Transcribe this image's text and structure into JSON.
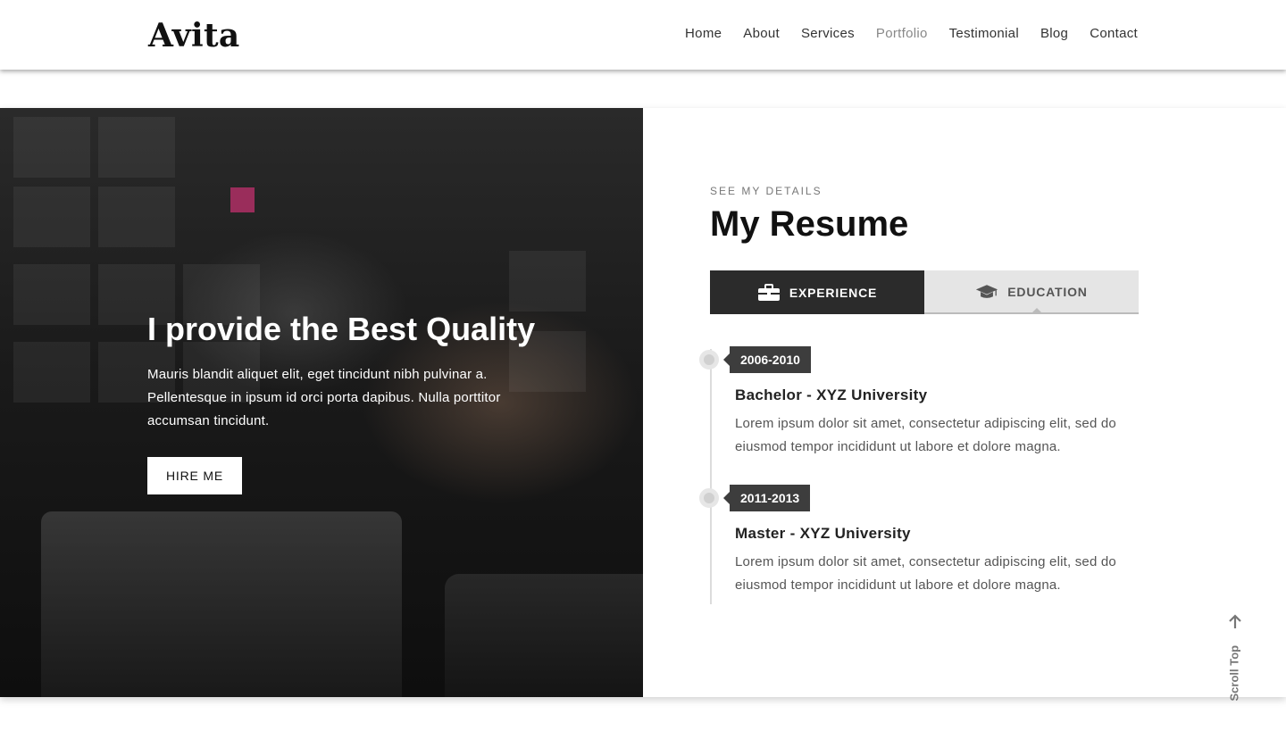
{
  "header": {
    "brand": "Avita",
    "nav": [
      {
        "label": "Home",
        "active": false
      },
      {
        "label": "About",
        "active": false
      },
      {
        "label": "Services",
        "active": false
      },
      {
        "label": "Portfolio",
        "active": true
      },
      {
        "label": "Testimonial",
        "active": false
      },
      {
        "label": "Blog",
        "active": false
      },
      {
        "label": "Contact",
        "active": false
      }
    ]
  },
  "hero": {
    "title": "I provide the Best Quality",
    "text": "Mauris blandit aliquet elit, eget tincidunt nibh pulvinar a. Pellentesque in ipsum id orci porta dapibus. Nulla porttitor accumsan tincidunt.",
    "button": "HIRE ME"
  },
  "resume": {
    "eyebrow": "SEE MY DETAILS",
    "title": "My Resume",
    "tabs": [
      {
        "label": "EXPERIENCE",
        "icon": "briefcase-icon",
        "active": true
      },
      {
        "label": "EDUCATION",
        "icon": "graduation-cap-icon",
        "active": false
      }
    ],
    "timeline": [
      {
        "date": "2006-2010",
        "title": "Bachelor - XYZ University",
        "desc": "Lorem ipsum dolor sit amet, consectetur adipiscing elit, sed do eiusmod tempor incididunt ut labore et dolore magna."
      },
      {
        "date": "2011-2013",
        "title": "Master - XYZ University",
        "desc": "Lorem ipsum dolor sit amet, consectetur adipiscing elit, sed do eiusmod tempor incididunt ut labore et dolore magna."
      }
    ]
  },
  "scroll_top": {
    "label": "Scroll Top",
    "icon": "arrow-up-icon"
  },
  "colors": {
    "dark": "#2b2b2b",
    "tab_inactive": "#e5e5e5",
    "muted": "#888888"
  }
}
